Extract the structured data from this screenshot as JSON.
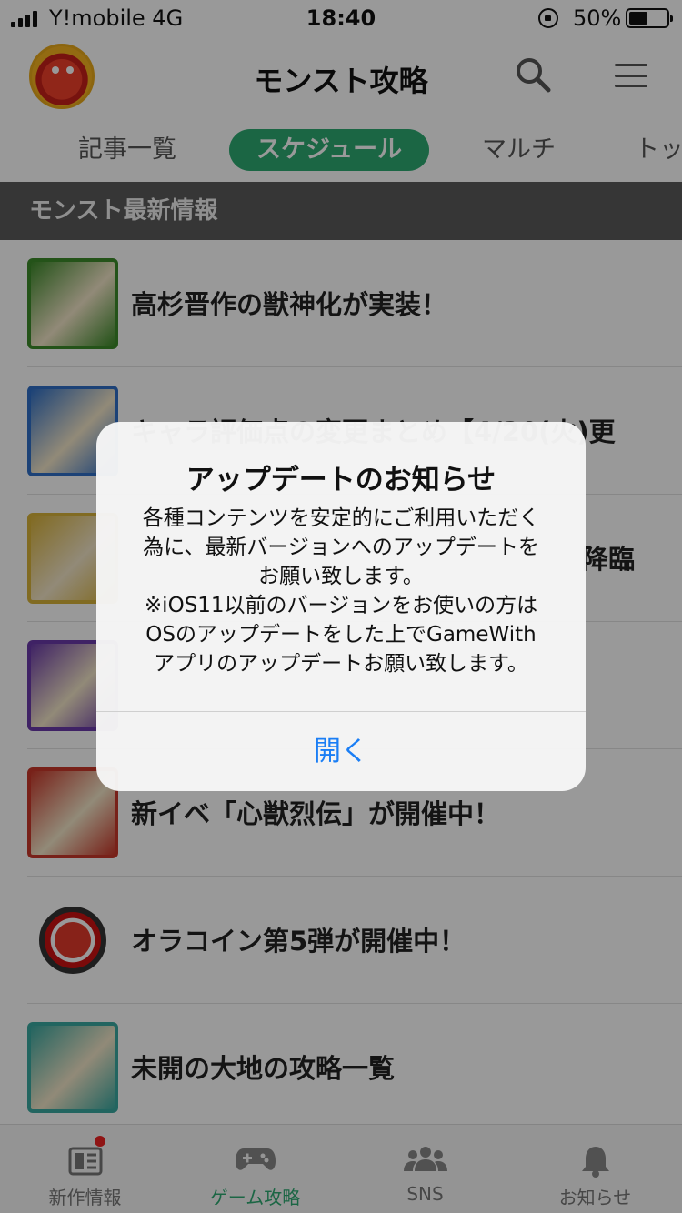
{
  "status_bar": {
    "carrier": "Y!mobile  4G",
    "time": "18:40",
    "battery_percent": "50%",
    "battery_level": 0.5
  },
  "header": {
    "title": "モンスト攻略",
    "avatar_icon": "monster-avatar-icon",
    "search_icon": "search-icon",
    "menu_icon": "hamburger-menu-icon"
  },
  "tabs": [
    {
      "label": "記事一覧",
      "active": false
    },
    {
      "label": "スケジュール",
      "active": true
    },
    {
      "label": "マルチ",
      "active": false
    },
    {
      "label": "トッ",
      "active": false
    }
  ],
  "section": {
    "title": "モンスト最新情報"
  },
  "list": [
    {
      "title": "高杉晋作の獣神化が実装！",
      "thumb_color": "#3d8a2a"
    },
    {
      "title": "キャラ評価点の変更まとめ【4/20(火)更",
      "thumb_color": "#2f6fc7"
    },
    {
      "title": "降臨",
      "thumb_color": "#d8b23a"
    },
    {
      "title": "",
      "thumb_color": "#6a3aa8"
    },
    {
      "title": "新イベ「心獣烈伝」が開催中！",
      "thumb_color": "#c8382a"
    },
    {
      "title": "オラコイン第5弾が開催中！",
      "thumb_color": "#c11"
    },
    {
      "title": "未開の大地の攻略一覧",
      "thumb_color": "#3aa8a0"
    }
  ],
  "bottom_nav": [
    {
      "label": "新作情報",
      "icon": "news-icon",
      "active": false,
      "badge": true
    },
    {
      "label": "ゲーム攻略",
      "icon": "gamepad-icon",
      "active": true,
      "badge": false
    },
    {
      "label": "SNS",
      "icon": "people-icon",
      "active": false,
      "badge": false
    },
    {
      "label": "お知らせ",
      "icon": "bell-icon",
      "active": false,
      "badge": false
    }
  ],
  "alert": {
    "title": "アップデートのお知らせ",
    "message": "各種コンテンツを安定的にご利用いただく\n為に、最新バージョンへのアップデートを\nお願い致します。\n※iOS11以前のバージョンをお使いの方は\nOSのアップデートをした上でGameWith\nアプリのアップデートお願い致します。",
    "button": "開く"
  },
  "colors": {
    "accent": "#2eaa72",
    "alert_button": "#1a7ef5",
    "section_bg": "#5a5a5a"
  }
}
